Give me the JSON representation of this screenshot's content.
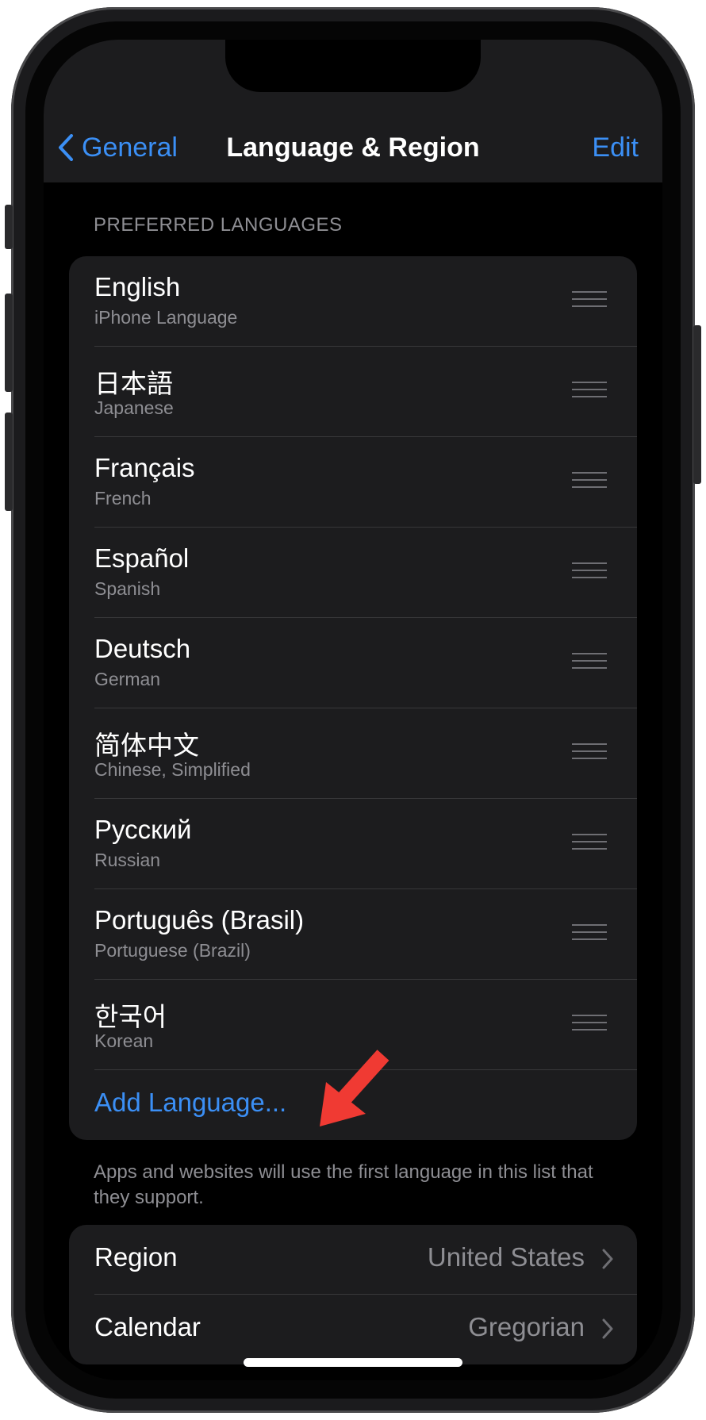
{
  "nav": {
    "back_label": "General",
    "title": "Language & Region",
    "edit_label": "Edit"
  },
  "preferred_languages": {
    "header": "PREFERRED LANGUAGES",
    "items": [
      {
        "name": "English",
        "sub": "iPhone Language"
      },
      {
        "name": "日本語",
        "sub": "Japanese"
      },
      {
        "name": "Français",
        "sub": "French"
      },
      {
        "name": "Español",
        "sub": "Spanish"
      },
      {
        "name": "Deutsch",
        "sub": "German"
      },
      {
        "name": "简体中文",
        "sub": "Chinese, Simplified"
      },
      {
        "name": "Русский",
        "sub": "Russian"
      },
      {
        "name": "Português (Brasil)",
        "sub": "Portuguese (Brazil)"
      },
      {
        "name": "한국어",
        "sub": "Korean"
      }
    ],
    "add_label": "Add Language...",
    "footer": "Apps and websites will use the first language in this list that they support."
  },
  "settings": {
    "region_label": "Region",
    "region_value": "United States",
    "calendar_label": "Calendar",
    "calendar_value": "Gregorian"
  },
  "colors": {
    "accent": "#3b8ff5",
    "annotation_arrow": "#f03a33"
  }
}
